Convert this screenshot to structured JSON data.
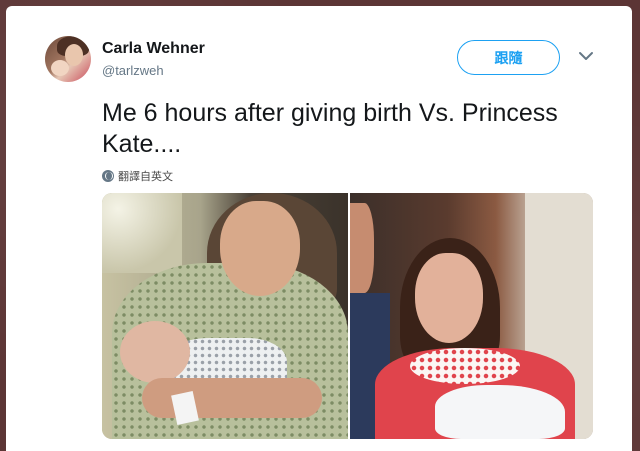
{
  "tweet": {
    "author": {
      "name": "Carla Wehner",
      "handle": "@tarlzweh"
    },
    "follow_label": "跟隨",
    "text": "Me 6 hours after giving birth Vs. Princess Kate....",
    "translate_label": "翻譯自英文",
    "media_count": 2
  },
  "icons": {
    "caret": "chevron-down-icon",
    "translate": "globe-icon"
  },
  "colors": {
    "accent": "#1da1f2",
    "text_primary": "#14171a",
    "text_secondary": "#657786"
  }
}
